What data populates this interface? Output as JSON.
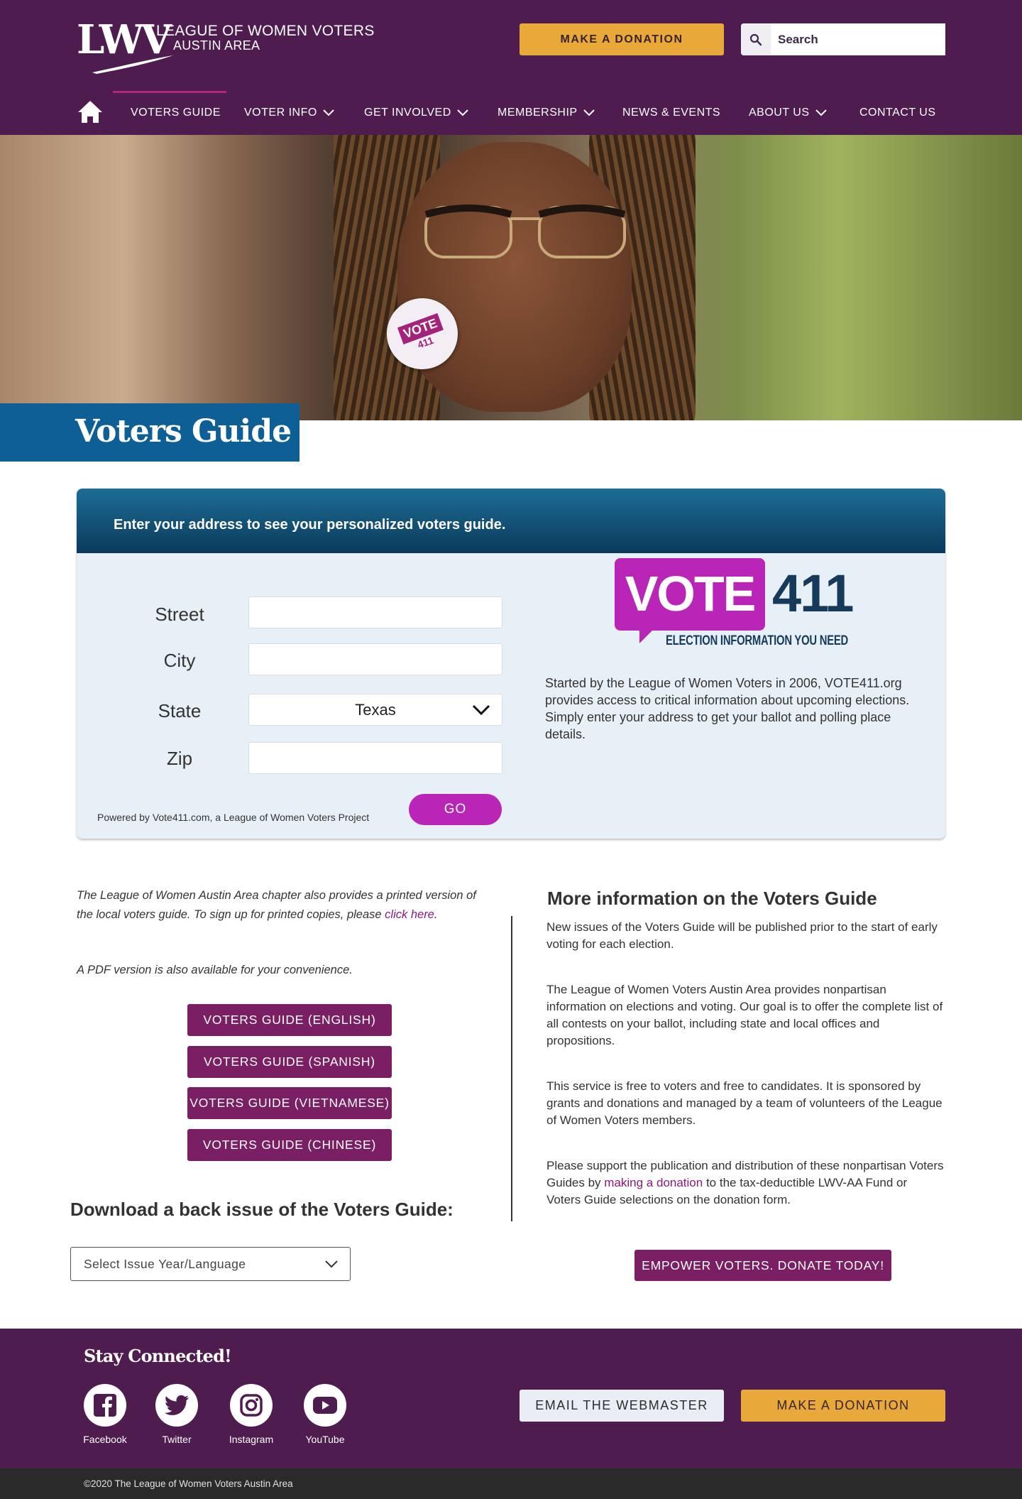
{
  "header": {
    "logo_mark": "LWV",
    "logo_line1": "LEAGUE OF WOMEN VOTERS",
    "logo_line2": "AUSTIN AREA",
    "donate_label": "MAKE A DONATION",
    "search_placeholder": "Search",
    "brand_color": "#4f1c4f",
    "accent_color": "#e8a93a"
  },
  "nav": {
    "items": [
      {
        "label": "VOTERS GUIDE",
        "has_dropdown": false,
        "active": true
      },
      {
        "label": "VOTER INFO",
        "has_dropdown": true
      },
      {
        "label": "GET INVOLVED",
        "has_dropdown": true
      },
      {
        "label": "MEMBERSHIP",
        "has_dropdown": true
      },
      {
        "label": "NEWS & EVENTS",
        "has_dropdown": false
      },
      {
        "label": "ABOUT US",
        "has_dropdown": true
      },
      {
        "label": "CONTACT US",
        "has_dropdown": false
      }
    ]
  },
  "hero": {
    "button_text_top": "VOTE",
    "button_text_bottom": "411",
    "page_title": "Voters Guide"
  },
  "vote411": {
    "heading": "Enter your address to see your personalized voters guide.",
    "fields": {
      "street_label": "Street",
      "city_label": "City",
      "state_label": "State",
      "state_value": "Texas",
      "zip_label": "Zip"
    },
    "powered_by": "Powered by Vote411.com, a League of Women Voters Project",
    "go_label": "GO",
    "logo_vote": "VOTE",
    "logo_num": "411",
    "logo_tagline": "ELECTION INFORMATION YOU NEED",
    "description": "Started by the League of Women Voters in 2006, VOTE411.org provides access to critical information about upcoming elections. Simply enter your address to get your ballot and polling place details.",
    "accent_color": "#b926b7"
  },
  "left": {
    "intro_text": "The League of Women Austin Area chapter also provides a printed version of the local voters guide. To sign up for printed copies, please",
    "intro_link": "click here",
    "intro_end": ".",
    "pdf_text": "A PDF version is also available for your convenience.",
    "guide_buttons": [
      "VOTERS GUIDE (ENGLISH)",
      "VOTERS GUIDE (SPANISH)",
      "VOTERS GUIDE (VIETNAMESE)",
      "VOTERS GUIDE (CHINESE)"
    ],
    "back_issue_title": "Download a back issue of the Voters Guide:",
    "back_issue_select": "Select Issue Year/Language"
  },
  "right": {
    "title": "More information on the Voters Guide",
    "p1": "New issues of the Voters Guide will be published prior to the start of early voting for each election.",
    "p2": "The League of Women Voters Austin Area provides nonpartisan information on elections and voting. Our goal is to offer the complete list of all contests on your ballot, including state and local offices and propositions.",
    "p3": "This service is free to voters and free to candidates. It is sponsored by grants and donations and managed by a team of volunteers of the League of Women Voters members.",
    "p4_start": "Please support the publication and distribution of these nonpartisan Voters Guides by",
    "p4_link": "making a donation",
    "p4_end": "to the tax-deductible LWV-AA Fund or Voters Guide selections on the donation form.",
    "empower_label": "EMPOWER VOTERS. DONATE TODAY!"
  },
  "footer": {
    "stay_connected": "Stay Connected!",
    "social": [
      {
        "label": "Facebook",
        "icon": "facebook-icon"
      },
      {
        "label": "Twitter",
        "icon": "twitter-icon"
      },
      {
        "label": "Instagram",
        "icon": "instagram-icon"
      },
      {
        "label": "YouTube",
        "icon": "youtube-icon"
      }
    ],
    "email_label": "EMAIL THE WEBMASTER",
    "donate_label": "MAKE A DONATION",
    "copyright": "©2020 The League of Women Voters Austin Area"
  }
}
